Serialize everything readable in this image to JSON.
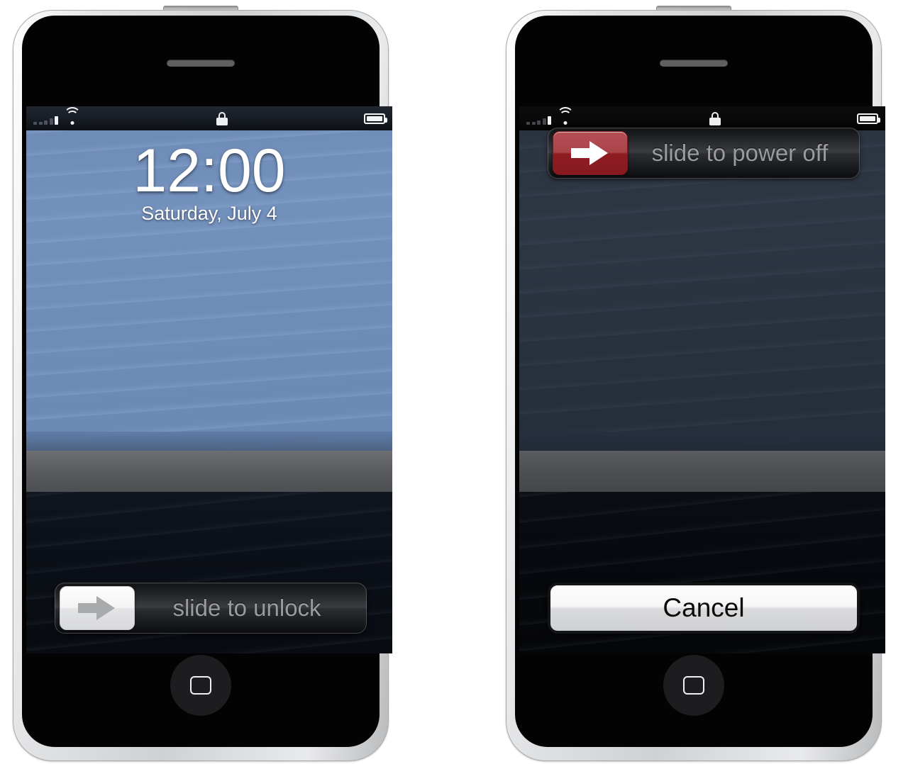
{
  "scene": {
    "description": "Two smartphone mockups side by side showing lock screen and power off screen"
  },
  "phones": [
    {
      "id": "lock-screen-phone",
      "hardware": {
        "speaker_grille": "speaker-grille",
        "home_button": "home-button",
        "power_tab": "power-button-tab"
      },
      "status_bar": {
        "signal_icon": "signal-bars-icon",
        "signal_bars_total": 5,
        "signal_bars_active": 1,
        "wifi_icon": "wifi-icon",
        "lock_icon": "lock-icon",
        "battery_icon": "battery-icon",
        "battery_level": "full"
      },
      "clock": {
        "time": "12:00",
        "date": "Saturday, July 4"
      },
      "slider": {
        "label": "slide to unlock",
        "knob_icon": "right-arrow-icon",
        "knob_color": "#f4f4f5",
        "track_color": "#1a1c1f"
      }
    },
    {
      "id": "power-off-phone",
      "hardware": {
        "speaker_grille": "speaker-grille",
        "home_button": "home-button",
        "power_tab": "power-button-tab"
      },
      "status_bar": {
        "signal_icon": "signal-bars-icon",
        "signal_bars_total": 5,
        "signal_bars_active": 1,
        "wifi_icon": "wifi-icon",
        "lock_icon": "lock-icon",
        "battery_icon": "battery-icon",
        "battery_level": "full"
      },
      "slider": {
        "label": "slide to power off",
        "knob_icon": "right-arrow-icon",
        "knob_color": "#a8444a",
        "track_color": "#1a1c1f"
      },
      "cancel_button": {
        "label": "Cancel"
      }
    }
  ],
  "colors": {
    "device_bezel": "#cfd1d3",
    "device_face": "#030303",
    "wallpaper_sky": "#6d8ab5",
    "wallpaper_dark": "#10141d",
    "slider_knob_red": "#a8444a",
    "slider_text": "#9b9c9e",
    "status_icon": "#f2f3f5"
  }
}
